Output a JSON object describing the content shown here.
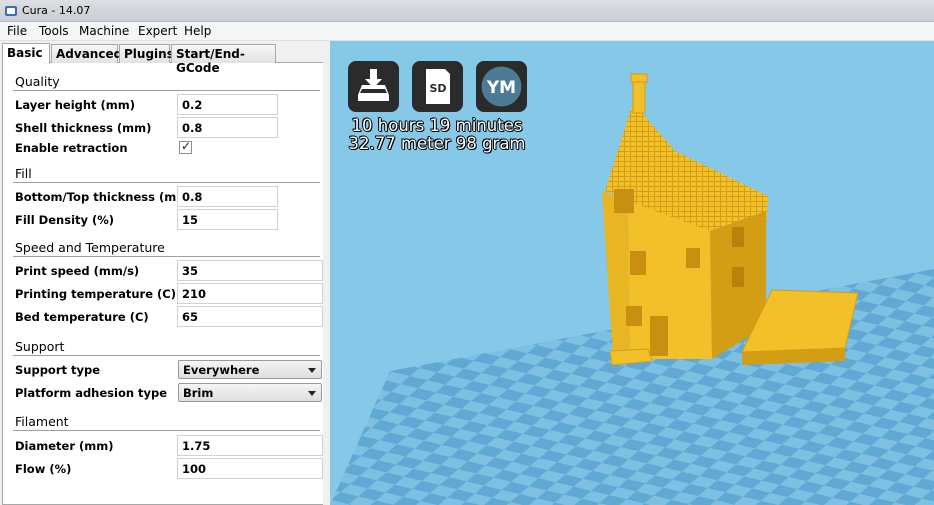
{
  "window": {
    "title": "Cura - 14.07"
  },
  "menu": [
    "File",
    "Tools",
    "Machine",
    "Expert",
    "Help"
  ],
  "tabs": [
    "Basic",
    "Advanced",
    "Plugins",
    "Start/End-GCode"
  ],
  "sections": {
    "quality": {
      "title": "Quality",
      "layer_height": {
        "label": "Layer height (mm)",
        "value": "0.2"
      },
      "shell_thickness": {
        "label": "Shell thickness (mm)",
        "value": "0.8"
      },
      "retraction": {
        "label": "Enable retraction",
        "checked": true
      }
    },
    "fill": {
      "title": "Fill",
      "bottom_top": {
        "label": "Bottom/Top thickness (mm)",
        "value": "0.8"
      },
      "density": {
        "label": "Fill Density (%)",
        "value": "15"
      }
    },
    "speed": {
      "title": "Speed and Temperature",
      "print_speed": {
        "label": "Print speed (mm/s)",
        "value": "35"
      },
      "print_temp": {
        "label": "Printing temperature (C)",
        "value": "210"
      },
      "bed_temp": {
        "label": "Bed temperature (C)",
        "value": "65"
      }
    },
    "support": {
      "title": "Support",
      "support_type": {
        "label": "Support type",
        "value": "Everywhere"
      },
      "adhesion": {
        "label": "Platform adhesion type",
        "value": "Brim"
      }
    },
    "filament": {
      "title": "Filament",
      "diameter": {
        "label": "Diameter (mm)",
        "value": "1.75"
      },
      "flow": {
        "label": "Flow (%)",
        "value": "100"
      }
    }
  },
  "viewport": {
    "buttons": [
      {
        "icon": "load-model-icon"
      },
      {
        "icon": "sd-card-icon",
        "label": "SD"
      },
      {
        "icon": "youmagine-icon",
        "label": "YM"
      }
    ],
    "print_time": "10 hours 19 minutes",
    "print_material": "32.77 meter 98 gram",
    "colors": {
      "sky": "#86c8e8",
      "plate_light": "#7ec0e2",
      "plate_dark": "#5fa9d4",
      "model": "#f2c029",
      "model_shade": "#d49e14"
    }
  }
}
